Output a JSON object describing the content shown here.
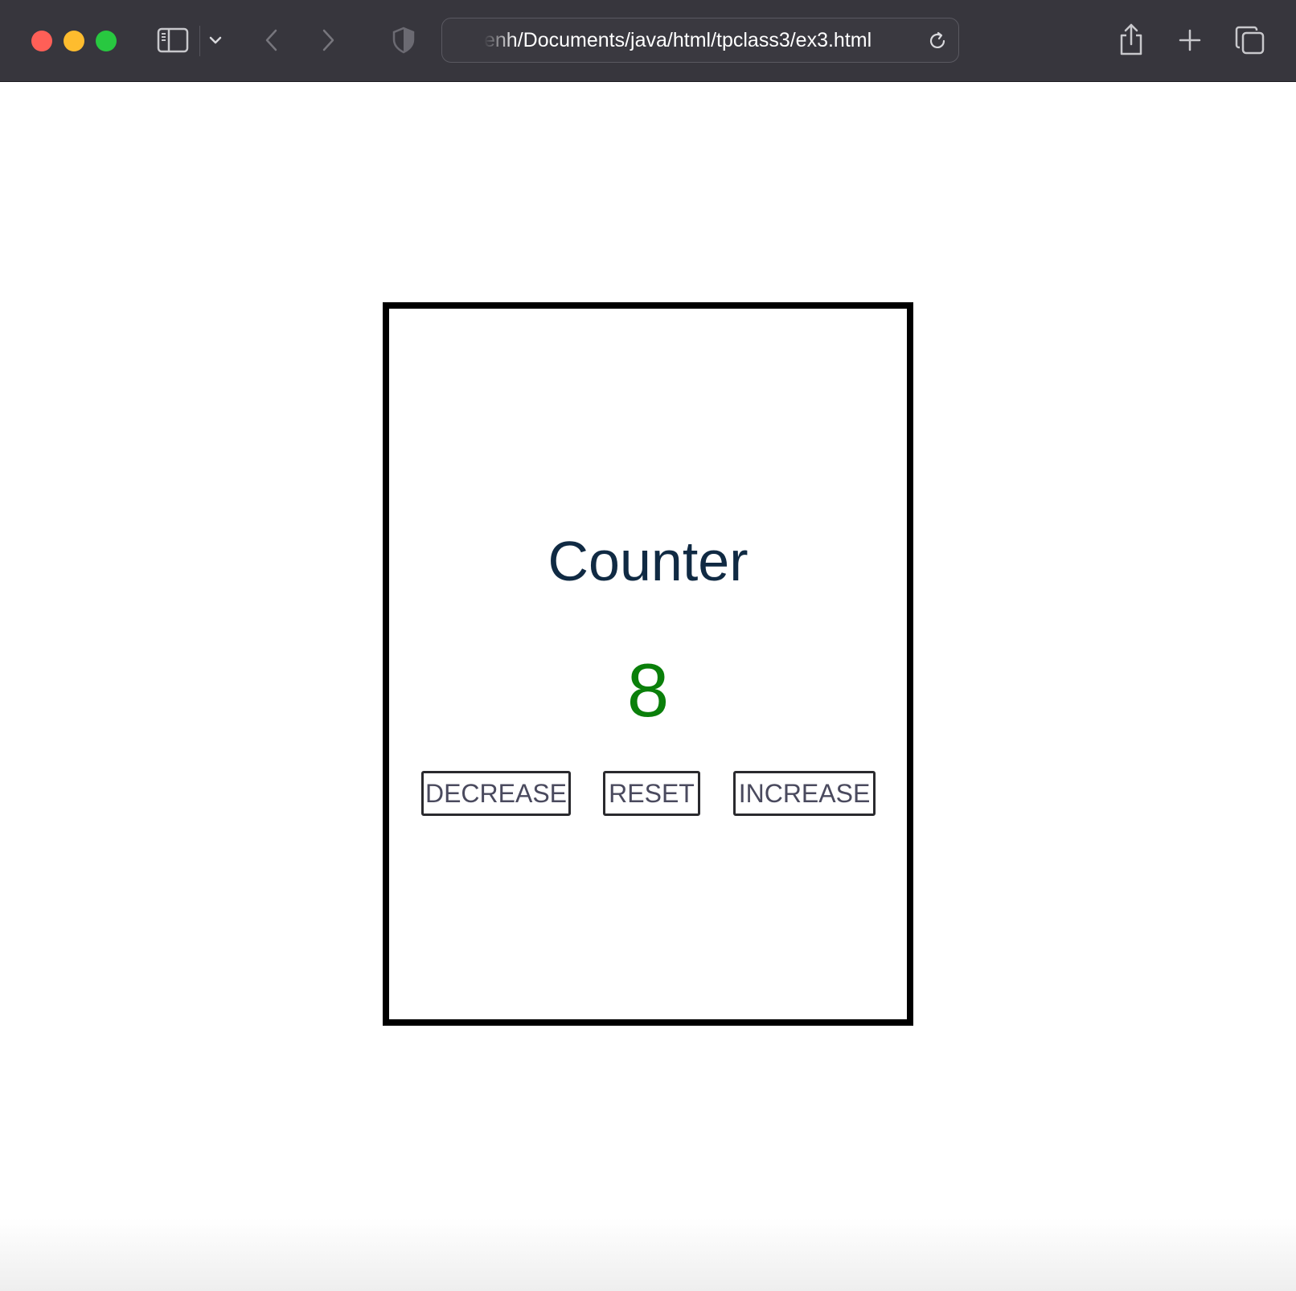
{
  "browser": {
    "url": "enh/Documents/java/html/tpclass3/ex3.html",
    "icons": {
      "sidebar": "sidebar-icon",
      "chevron": "chevron-down-icon",
      "back": "back-arrow-icon",
      "forward": "forward-arrow-icon",
      "privacy": "shield-icon",
      "reload": "reload-icon",
      "share": "share-icon",
      "new_tab": "plus-icon",
      "tab_overview": "tabs-icon"
    },
    "colors": {
      "toolbar": "#37363d",
      "close": "#ff5f57",
      "minimize": "#febc2e",
      "zoom": "#28c840"
    }
  },
  "counter": {
    "title": "Counter",
    "value": "8",
    "value_color": "#0a7f0a",
    "buttons": {
      "decrease": "DECREASE",
      "reset": "RESET",
      "increase": "INCREASE"
    }
  }
}
